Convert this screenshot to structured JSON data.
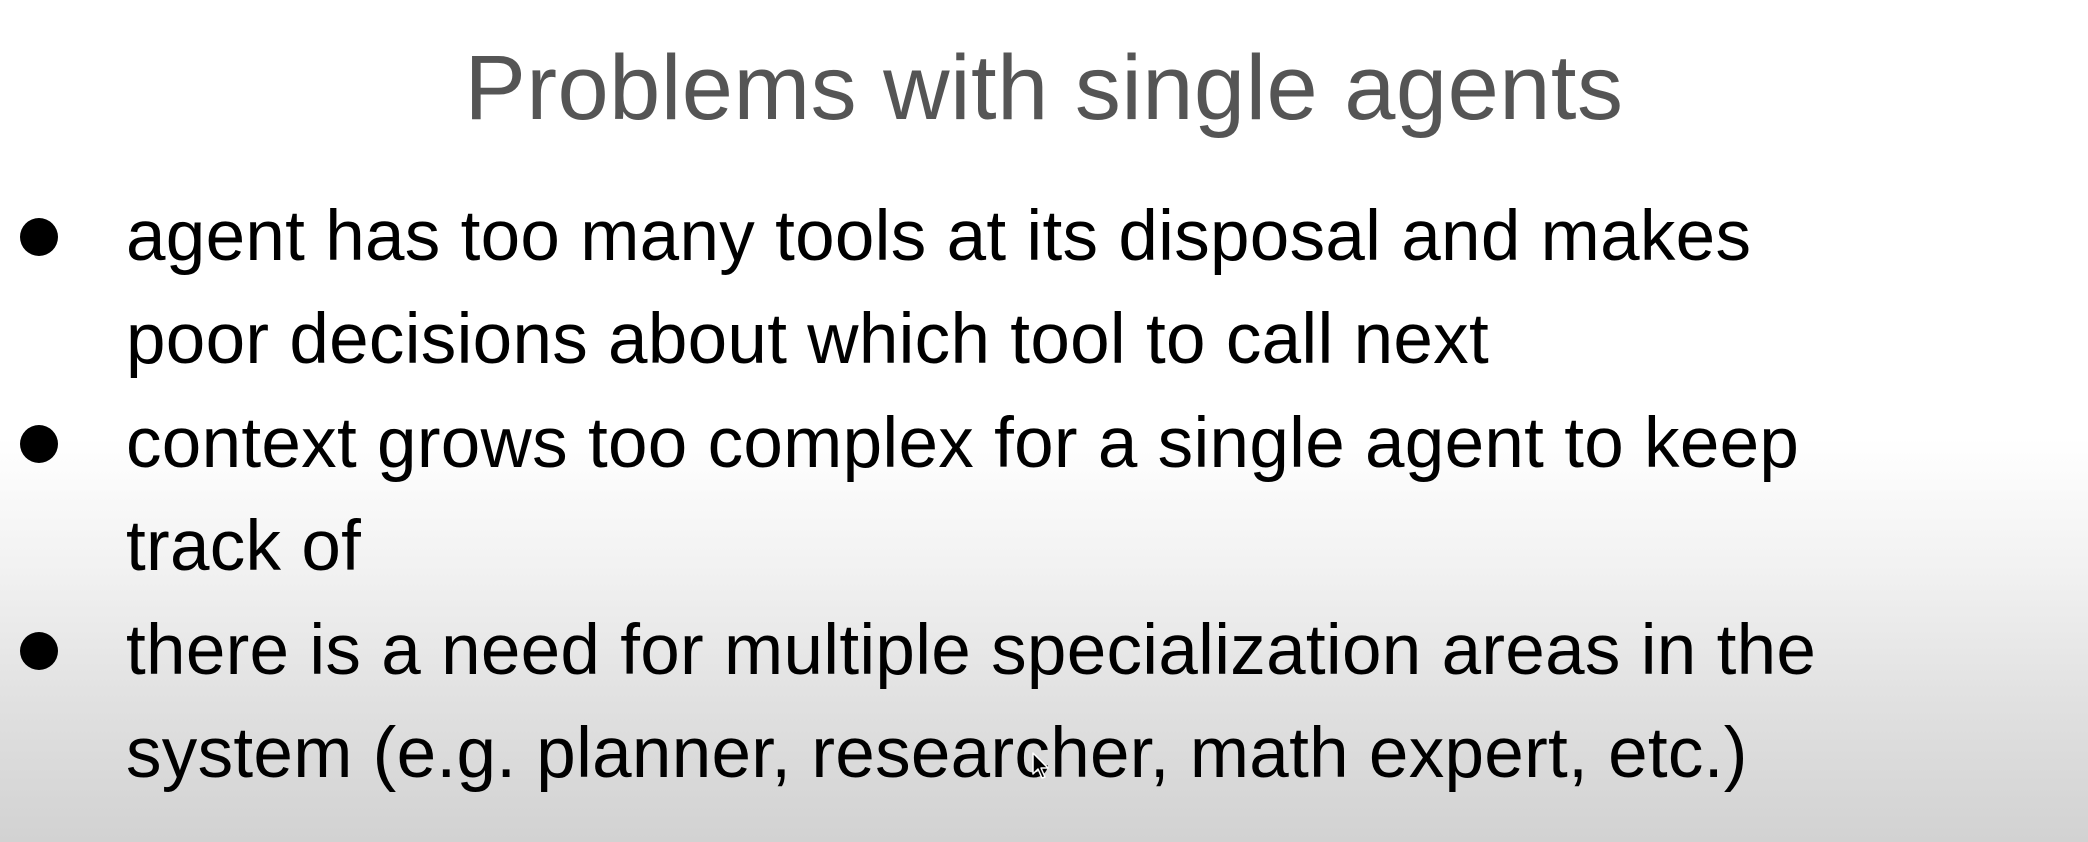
{
  "slide": {
    "title": "Problems with single agents",
    "bullets": [
      {
        "line1": "agent has too many tools at its disposal and makes",
        "line2": "poor decisions about which tool to call next"
      },
      {
        "line1": "context grows too complex for a single agent to keep",
        "line2": "track of"
      },
      {
        "line1": "there is a need for multiple specialization areas in the",
        "line2": "system (e.g. planner, researcher, math expert, etc.)"
      }
    ]
  },
  "icons": {
    "bullet": "filled-circle",
    "cursor": "mouse-pointer-icon"
  }
}
